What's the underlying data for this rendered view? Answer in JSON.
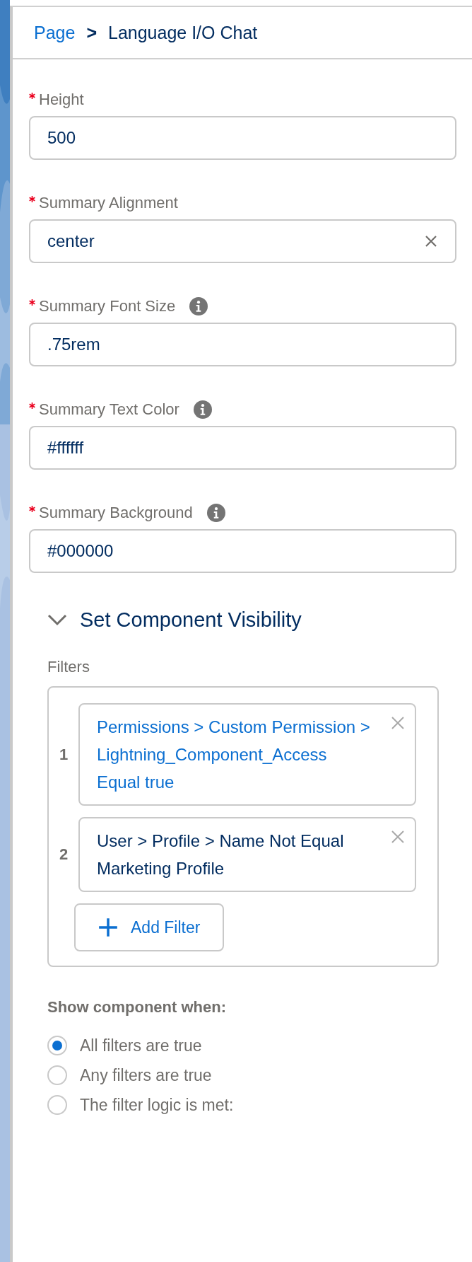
{
  "breadcrumb": {
    "parent": "Page",
    "separator": ">",
    "current": "Language I/O Chat"
  },
  "fields": [
    {
      "label": "Height",
      "required": true,
      "info": false,
      "value": "500",
      "clearable": false
    },
    {
      "label": "Summary Alignment",
      "required": true,
      "info": false,
      "value": "center",
      "clearable": true
    },
    {
      "label": "Summary Font Size",
      "required": true,
      "info": true,
      "value": ".75rem",
      "clearable": false
    },
    {
      "label": "Summary Text Color",
      "required": true,
      "info": true,
      "value": "#ffffff",
      "clearable": false
    },
    {
      "label": "Summary Background",
      "required": true,
      "info": true,
      "value": "#000000",
      "clearable": false
    }
  ],
  "visibility": {
    "title": "Set Component Visibility",
    "expanded": true,
    "filters_label": "Filters",
    "filters": [
      {
        "number": "1",
        "text": "Permissions > Custom Permission > Lightning_Component_Access Equal true",
        "selected": true
      },
      {
        "number": "2",
        "text": "User > Profile > Name Not Equal Marketing Profile",
        "selected": false
      }
    ],
    "add_button": "Add Filter",
    "show_when": "Show component when:",
    "options": [
      {
        "label": "All filters are true",
        "selected": true
      },
      {
        "label": "Any filters are true",
        "selected": false
      },
      {
        "label": "The filter logic is met:",
        "selected": false
      }
    ]
  }
}
